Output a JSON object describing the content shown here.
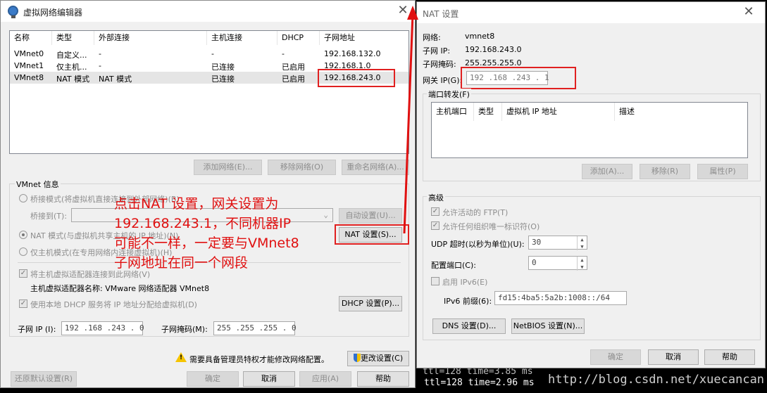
{
  "vne": {
    "title": "虚拟网络编辑器",
    "table": {
      "headers": [
        "名称",
        "类型",
        "外部连接",
        "主机连接",
        "DHCP",
        "子网地址"
      ],
      "rows": [
        [
          "VMnet0",
          "自定义...",
          "-",
          "-",
          "-",
          "192.168.132.0"
        ],
        [
          "VMnet1",
          "仅主机...",
          "-",
          "已连接",
          "已启用",
          "192.168.1.0"
        ],
        [
          "VMnet8",
          "NAT 模式",
          "NAT 模式",
          "已连接",
          "已启用",
          "192.168.243.0"
        ]
      ]
    },
    "add_network": "添加网络(E)...",
    "remove_network": "移除网络(O)",
    "rename_network": "重命名网络(A)...",
    "info_label": "VMnet 信息",
    "bridged_mode": "桥接模式(将虚拟机直接连接到外部网络)(B)",
    "bridged_to": "桥接到(T):",
    "auto_settings": "自动设置(U)...",
    "nat_mode": "NAT 模式(与虚拟机共享主机的 IP 地址)(N)",
    "nat_settings": "NAT 设置(S)...",
    "host_only_mode": "仅主机模式(在专用网络内连接虚拟机)(H)",
    "connect_adapter": "将主机虚拟适配器连接到此网络(V)",
    "adapter_name": "主机虚拟适配器名称: VMware 网络适配器 VMnet8",
    "use_dhcp": "使用本地 DHCP 服务将 IP 地址分配给虚拟机(D)",
    "dhcp_settings": "DHCP 设置(P)...",
    "subnet_ip_label": "子网 IP (I):",
    "subnet_ip": "192 .168 .243 . 0",
    "subnet_mask_label": "子网掩码(M):",
    "subnet_mask": "255 .255 .255 . 0",
    "admin_notice": "需要具备管理员特权才能修改网络配置。",
    "change_settings": "更改设置(C)",
    "restore_defaults": "还原默认设置(R)",
    "ok": "确定",
    "cancel": "取消",
    "apply": "应用(A)",
    "help": "帮助"
  },
  "nat": {
    "title": "NAT 设置",
    "network_label": "网络:",
    "network": "vmnet8",
    "subnet_ip_label": "子网 IP:",
    "subnet_ip": "192.168.243.0",
    "subnet_mask_label": "子网掩码:",
    "subnet_mask": "255.255.255.0",
    "gateway_label": "网关 IP(G):",
    "gateway": "192 .168 .243 . 1",
    "port_forwarding": "端口转发(F)",
    "pf_headers": [
      "主机端口",
      "类型",
      "虚拟机 IP 地址",
      "描述"
    ],
    "add": "添加(A)...",
    "remove": "移除(R)",
    "properties": "属性(P)",
    "advanced": "高级",
    "allow_ftp": "允许活动的 FTP(T)",
    "allow_uuid": "允许任何组织唯一标识符(O)",
    "udp_timeout_label": "UDP 超时(以秒为单位)(U):",
    "udp_timeout": "30",
    "config_port_label": "配置端口(C):",
    "config_port": "0",
    "enable_ipv6": "启用 IPv6(E)",
    "ipv6_prefix_label": "IPv6 前缀(6):",
    "ipv6_prefix": "fd15:4ba5:5a2b:1008::/64",
    "dns_settings": "DNS 设置(D)...",
    "netbios_settings": "NetBIOS 设置(N)...",
    "ok": "确定",
    "cancel": "取消",
    "help": "帮助"
  },
  "annotation": {
    "line1": "点击NAT 设置，网关设置为",
    "line2": "192.168.243.1，不同机器IP",
    "line3": "可能不一样，一定要与VMnet8",
    "line4": "子网地址在同一个网段"
  },
  "terminal": {
    "line1": "ttl=128 time=3.85 ms",
    "line2": "ttl=128 time=2.96 ms",
    "watermark": "http://blog.csdn.net/xuecancan"
  },
  "colors": {
    "annotation": "#e01010",
    "window_bg": "#f0f0f0",
    "selection": "#e5e5e5"
  }
}
